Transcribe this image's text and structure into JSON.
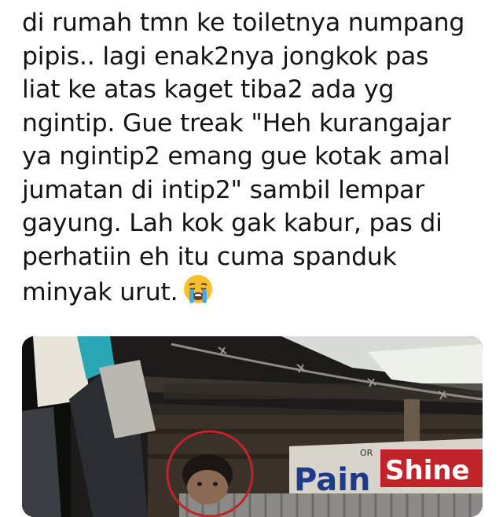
{
  "tweet": {
    "lines": [
      "di rumah tmn ke toiletnya numpang",
      "pipis.. lagi enak2nya jongkok pas",
      "liat ke atas kaget tiba2 ada yg",
      "ngintip. Gue treak \"Heh kurangajar",
      "ya ngintip2 emang gue kotak amal",
      "jumatan di intip2\" sambil lempar",
      "gayung. Lah kok gak kabur, pas di",
      "perhatiin eh itu cuma spanduk",
      "minyak urut."
    ],
    "emoji": "loudly-crying-face-icon"
  },
  "photo": {
    "banner_text_small": "OR",
    "banner_text_left": "Pain",
    "banner_text_right": "Shine",
    "highlight_color": "#c0242a"
  }
}
